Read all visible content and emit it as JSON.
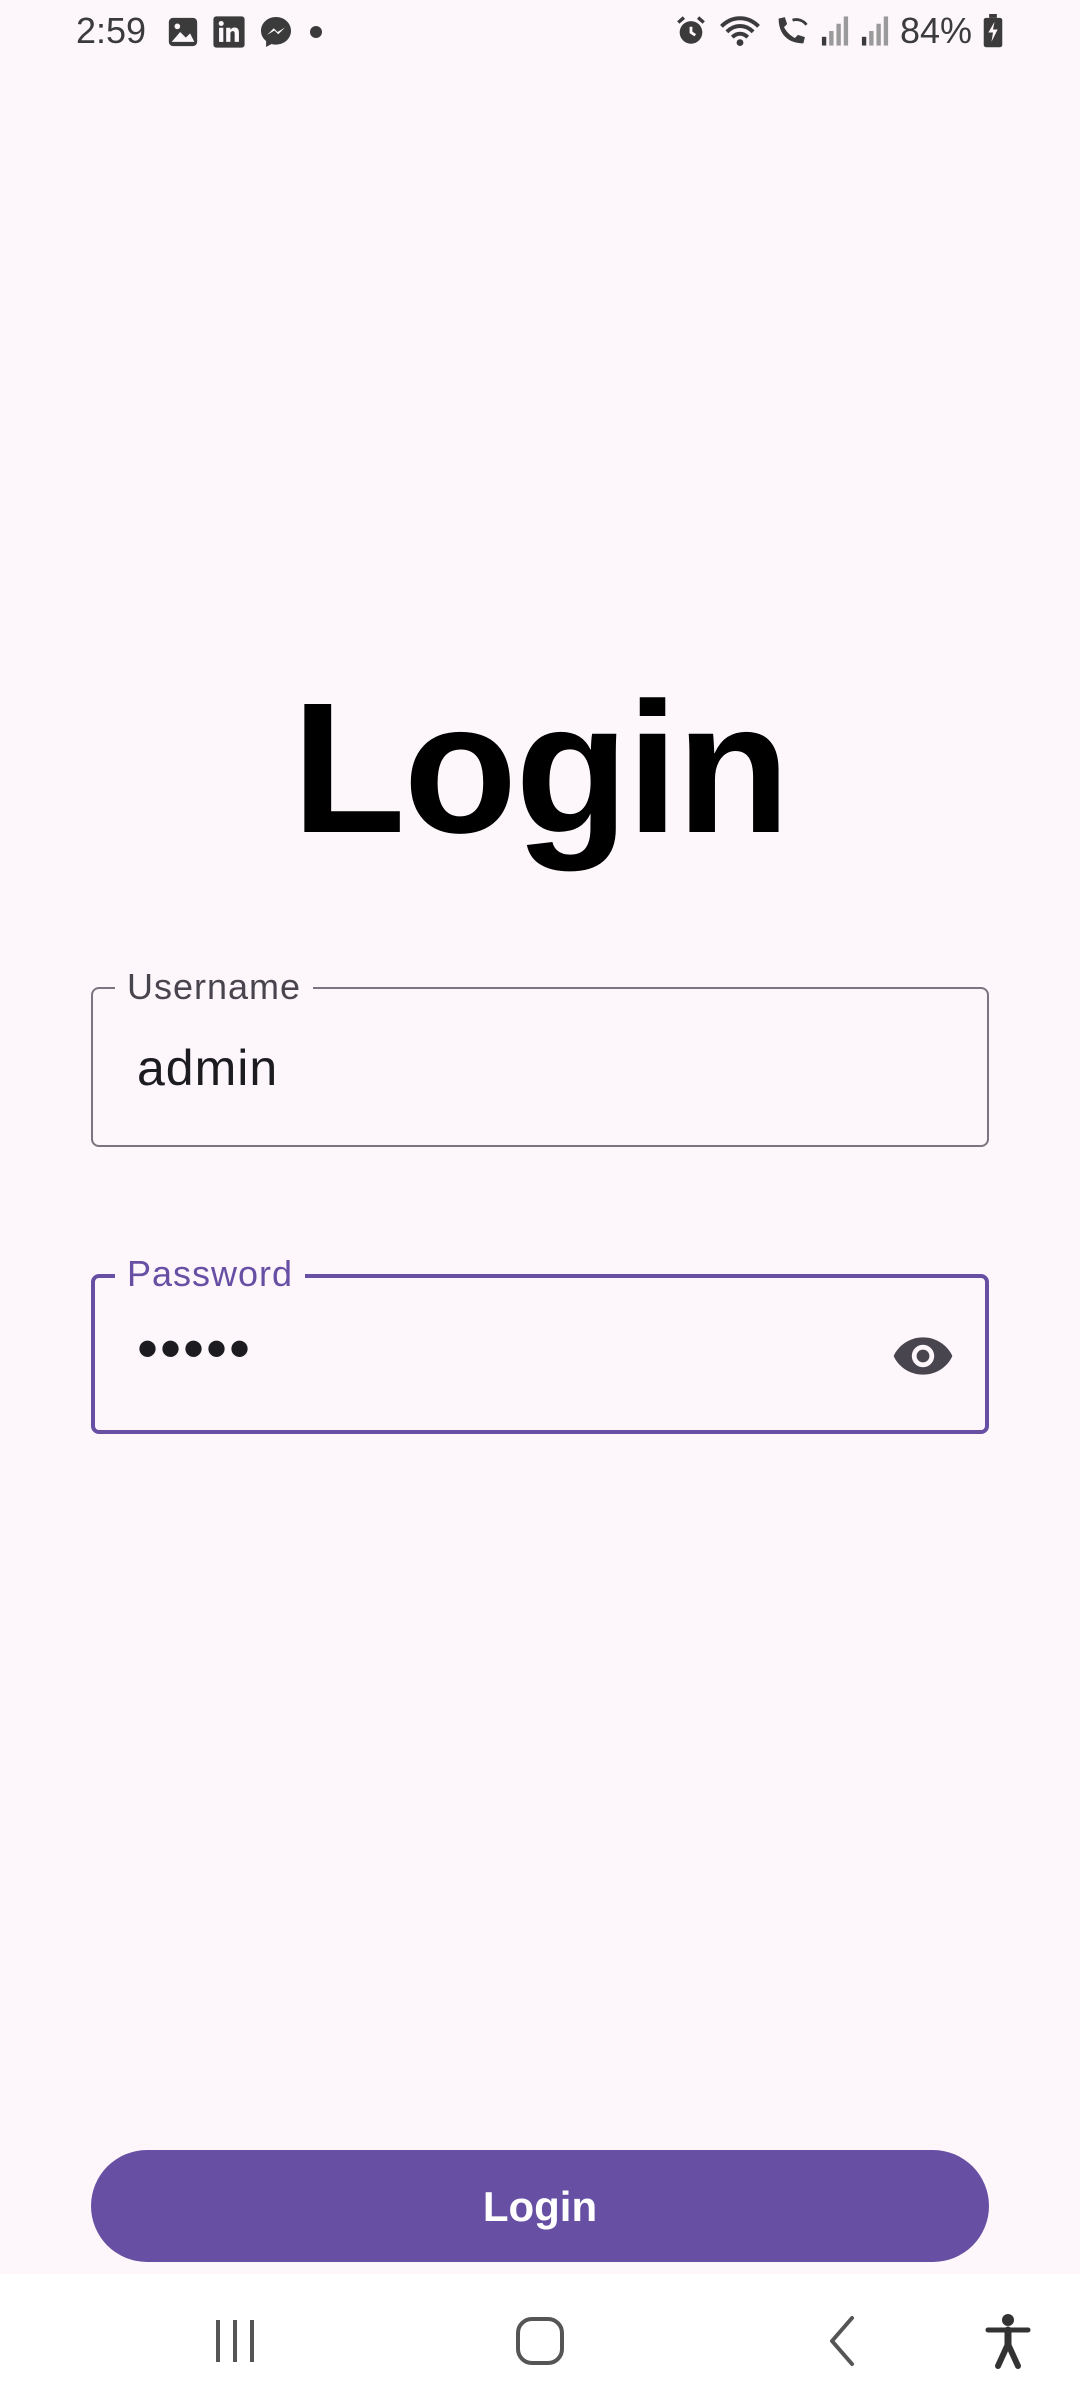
{
  "status_bar": {
    "time": "2:59",
    "battery": "84%",
    "left_icons": [
      "gallery-icon",
      "linkedin-icon",
      "messenger-icon",
      "dot-icon"
    ],
    "right_icons": [
      "alarm-icon",
      "wifi-icon",
      "wifi-call-icon",
      "signal-icon",
      "signal-icon",
      "battery-charging-icon"
    ]
  },
  "page": {
    "title": "Login"
  },
  "username": {
    "label": "Username",
    "value": "admin"
  },
  "password": {
    "label": "Password",
    "value": "•••••",
    "toggle_icon": "eye-icon"
  },
  "login_button": {
    "label": "Login"
  },
  "colors": {
    "accent": "#6750a4",
    "background": "#fdf7fc",
    "outline": "#7a757f"
  },
  "nav_bar": {
    "buttons": [
      "recents-icon",
      "home-icon",
      "back-icon",
      "accessibility-icon"
    ]
  }
}
